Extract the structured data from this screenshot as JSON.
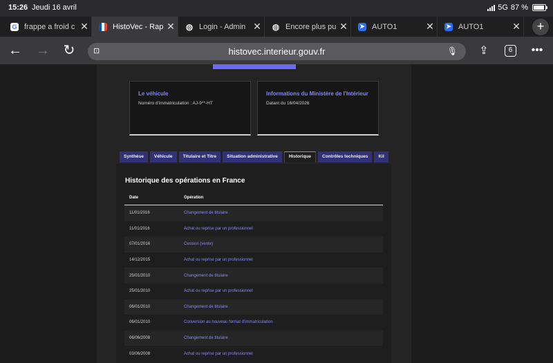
{
  "status": {
    "time": "15:26",
    "date": "Jeudi 16 avril",
    "network": "5G",
    "battery": "87 %"
  },
  "tabs": [
    {
      "title": "frappe a froid c",
      "favicon": "google-icon"
    },
    {
      "title": "HistoVec - Rap",
      "favicon": "french-flag-icon"
    },
    {
      "title": "Login - Admin",
      "favicon": "globe-icon"
    },
    {
      "title": "Encore plus pu",
      "favicon": "globe-icon"
    },
    {
      "title": "AUTO1",
      "favicon": "auto1-icon"
    },
    {
      "title": "AUTO1",
      "favicon": "auto1-icon"
    }
  ],
  "toolbar": {
    "url": "histovec.interieur.gouv.fr",
    "tab_count": "6"
  },
  "cards": {
    "vehicle": {
      "title": "Le véhicule",
      "subtitle": "Numéro d'immatriculation : AJ-9**-HT"
    },
    "ministry": {
      "title": "Informations du Ministère de l'Intérieur",
      "subtitle": "Datant du 16/04/2026"
    }
  },
  "nav_tabs": [
    "Synthèse",
    "Véhicule",
    "Titulaire et Titre",
    "Situation administrative",
    "Historique",
    "Contrôles techniques",
    "Kil"
  ],
  "history": {
    "title": "Historique des opérations en France",
    "columns": [
      "Date",
      "Opération"
    ],
    "rows": [
      {
        "date": "11/01/2016",
        "op": "Changement de titulaire"
      },
      {
        "date": "11/01/2016",
        "op": "Achat ou reprise par un professionnel"
      },
      {
        "date": "07/01/2016",
        "op": "Cession (vente)"
      },
      {
        "date": "14/12/2015",
        "op": "Achat ou reprise par un professionnel"
      },
      {
        "date": "25/01/2010",
        "op": "Changement de titulaire"
      },
      {
        "date": "25/01/2010",
        "op": "Achat ou reprise par un professionnel"
      },
      {
        "date": "06/01/2010",
        "op": "Changement de titulaire"
      },
      {
        "date": "06/01/2010",
        "op": "Conversion au nouveau format d'immatriculation"
      },
      {
        "date": "06/06/2008",
        "op": "Changement de titulaire"
      },
      {
        "date": "03/06/2008",
        "op": "Achat ou reprise par un professionnel"
      }
    ]
  },
  "colors": {
    "accent": "#8585f6",
    "tab_bg": "#313178"
  }
}
